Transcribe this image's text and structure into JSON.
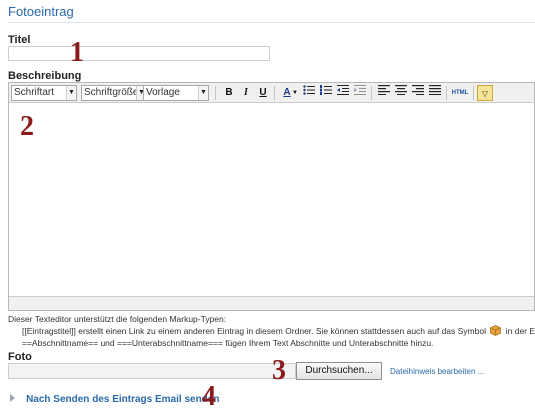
{
  "page": {
    "title": "Fotoeintrag"
  },
  "fields": {
    "title_label": "Titel",
    "title_value": "",
    "description_label": "Beschreibung",
    "photo_label": "Foto"
  },
  "editor": {
    "font_select": "Schriftart",
    "size_select": "Schriftgröße",
    "style_select": "Vorlage",
    "buttons": {
      "bold": "B",
      "italic": "I",
      "underline": "U",
      "font_color": "A",
      "html": "HTML"
    },
    "icons": [
      "bold-icon",
      "italic-icon",
      "underline-icon",
      "font-color-icon",
      "bullet-list-icon",
      "numbered-list-icon",
      "outdent-icon",
      "indent-icon",
      "align-left-icon",
      "align-center-icon",
      "align-right-icon",
      "align-justify-icon",
      "html-source-icon",
      "toggle-toolbar-icon"
    ]
  },
  "help": {
    "intro": "Dieser Texteditor unterstützt die folgenden Markup-Typen:",
    "line1_a": "[[Eintragstitel]] erstellt einen Link zu einem anderen Eintrag in diesem Ordner. Sie können stattdessen auch auf das Symbol",
    "line1_b": "in der Editor",
    "line2": "==Abschnittname== und ===Unterabschnittname=== fügen Ihrem Text Abschnitte und Unterabschnitte hinzu."
  },
  "photo": {
    "browse_label": "Durchsuchen...",
    "file_hint_link": "Dateihinweis bearbeiten ..."
  },
  "expander": {
    "label": "Nach Senden des Eintrags Email senden"
  },
  "markers": [
    "1",
    "2",
    "3",
    "4"
  ],
  "colors": {
    "accent": "#2a6aa8",
    "marker": "#8b1a1a"
  }
}
